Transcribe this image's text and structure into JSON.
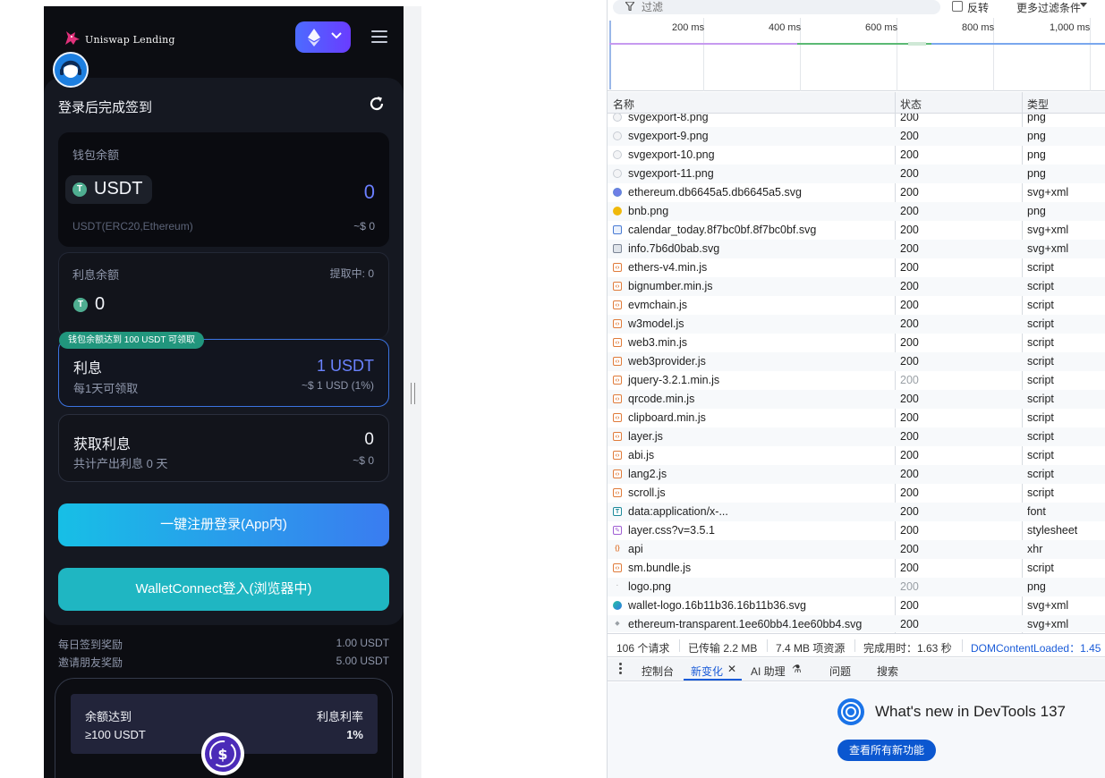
{
  "app": {
    "brand": "Uniswap Lending",
    "chain_icon": "ethereum-icon",
    "signin_title": "登录后完成签到",
    "wallet": {
      "label": "钱包余额",
      "coin": "USDT",
      "balance": "0",
      "network": "USDT(ERC20,Ethereum)",
      "usd": "~$ 0"
    },
    "interest_balance": {
      "label": "利息余额",
      "withdrawing": "提取中: 0",
      "value": "0"
    },
    "reward": {
      "badge": "钱包余额达到 100 USDT 可领取",
      "title": "利息",
      "subtitle": "每1天可领取",
      "amount": "1 USDT",
      "usd": "~$ 1 USD (1%)"
    },
    "earn": {
      "title": "获取利息",
      "subtitle": "共计产出利息 0 天",
      "amount": "0",
      "usd": "~$ 0"
    },
    "register_button": "一键注册登录(App内)",
    "walletconnect_button": "WalletConnect登入(浏览器中)",
    "daily_reward": {
      "label": "每日签到奖励",
      "value": "1.00 USDT"
    },
    "invite_reward": {
      "label": "邀请朋友奖励",
      "value": "5.00 USDT"
    },
    "rate_table": {
      "col1_header": "余额达到",
      "col2_header": "利息利率",
      "col1_value": "≥100 USDT",
      "col2_value": "1%"
    }
  },
  "devtools": {
    "filter_placeholder": "过滤",
    "invert_label": "反转",
    "more_filters": "更多过滤条件",
    "timeline_ticks": [
      "200 ms",
      "400 ms",
      "600 ms",
      "800 ms",
      "1,000 ms"
    ],
    "columns": {
      "name": "名称",
      "status": "状态",
      "type": "类型"
    },
    "requests": [
      {
        "name": "svgexport-8.png",
        "status": "200",
        "type": "png",
        "icon": "img"
      },
      {
        "name": "svgexport-9.png",
        "status": "200",
        "type": "png",
        "icon": "img"
      },
      {
        "name": "svgexport-10.png",
        "status": "200",
        "type": "png",
        "icon": "img"
      },
      {
        "name": "svgexport-11.png",
        "status": "200",
        "type": "png",
        "icon": "img"
      },
      {
        "name": "ethereum.db6645a5.db6645a5.svg",
        "status": "200",
        "type": "svg+xml",
        "icon": "svg"
      },
      {
        "name": "bnb.png",
        "status": "200",
        "type": "png",
        "icon": "bnb"
      },
      {
        "name": "calendar_today.8f7bc0bf.8f7bc0bf.svg",
        "status": "200",
        "type": "svg+xml",
        "icon": "cal"
      },
      {
        "name": "info.7b6d0bab.svg",
        "status": "200",
        "type": "svg+xml",
        "icon": "info"
      },
      {
        "name": "ethers-v4.min.js",
        "status": "200",
        "type": "script",
        "icon": "script"
      },
      {
        "name": "bignumber.min.js",
        "status": "200",
        "type": "script",
        "icon": "script"
      },
      {
        "name": "evmchain.js",
        "status": "200",
        "type": "script",
        "icon": "script"
      },
      {
        "name": "w3model.js",
        "status": "200",
        "type": "script",
        "icon": "script"
      },
      {
        "name": "web3.min.js",
        "status": "200",
        "type": "script",
        "icon": "script"
      },
      {
        "name": "web3provider.js",
        "status": "200",
        "type": "script",
        "icon": "script"
      },
      {
        "name": "jquery-3.2.1.min.js",
        "status": "200",
        "type": "script",
        "icon": "script",
        "dim": true
      },
      {
        "name": "qrcode.min.js",
        "status": "200",
        "type": "script",
        "icon": "script"
      },
      {
        "name": "clipboard.min.js",
        "status": "200",
        "type": "script",
        "icon": "script"
      },
      {
        "name": "layer.js",
        "status": "200",
        "type": "script",
        "icon": "script"
      },
      {
        "name": "abi.js",
        "status": "200",
        "type": "script",
        "icon": "script"
      },
      {
        "name": "lang2.js",
        "status": "200",
        "type": "script",
        "icon": "script"
      },
      {
        "name": "scroll.js",
        "status": "200",
        "type": "script",
        "icon": "script"
      },
      {
        "name": "data:application/x-...",
        "status": "200",
        "type": "font",
        "icon": "font"
      },
      {
        "name": "layer.css?v=3.5.1",
        "status": "200",
        "type": "stylesheet",
        "icon": "css"
      },
      {
        "name": "api",
        "status": "200",
        "type": "xhr",
        "icon": "xhr"
      },
      {
        "name": "sm.bundle.js",
        "status": "200",
        "type": "script",
        "icon": "script"
      },
      {
        "name": "logo.png",
        "status": "200",
        "type": "png",
        "icon": "logo",
        "dim": true
      },
      {
        "name": "wallet-logo.16b11b36.16b11b36.svg",
        "status": "200",
        "type": "svg+xml",
        "icon": "wlogo"
      },
      {
        "name": "ethereum-transparent.1ee60bb4.1ee60bb4.svg",
        "status": "200",
        "type": "svg+xml",
        "icon": "eth"
      }
    ],
    "summary": {
      "requests": "106 个请求",
      "transferred": "已传输 2.2 MB",
      "resources": "7.4 MB 项资源",
      "finish": "完成用时：1.63 秒",
      "dcl": "DOMContentLoaded：1.45"
    },
    "drawer_tabs": {
      "console": "控制台",
      "whats_new": "新变化",
      "ai": "AI 助理",
      "issues": "问题",
      "search": "搜索"
    },
    "whats_new_title": "What's new in DevTools 137",
    "see_all": "查看所有新功能"
  }
}
